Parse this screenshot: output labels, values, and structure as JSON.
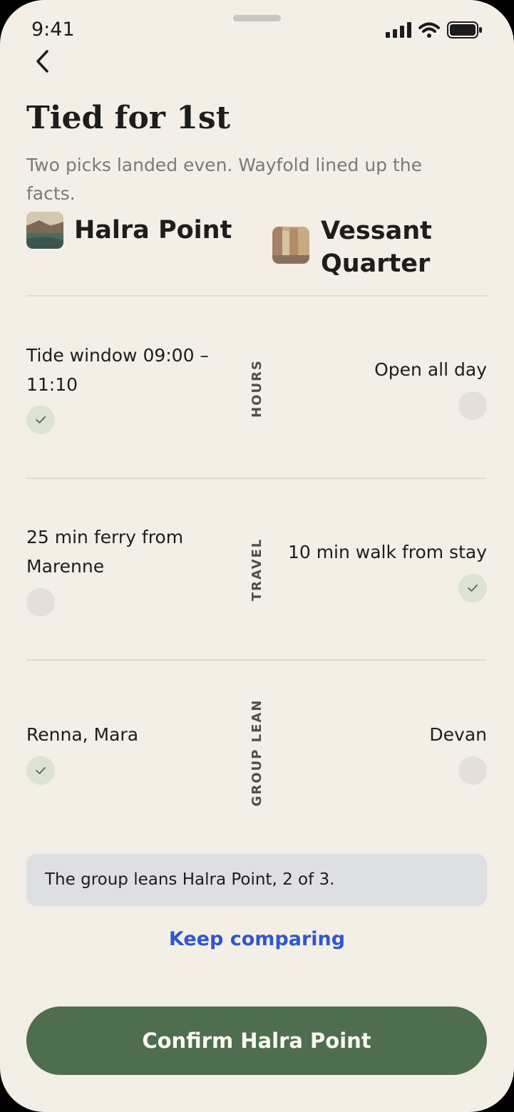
{
  "status": {
    "time": "9:41"
  },
  "header": {
    "title": "Tied for 1st",
    "subtitle": "Two picks landed even. Wayfold lined up the facts."
  },
  "options": [
    {
      "name": "Halra Point"
    },
    {
      "name": "Vessant Quarter"
    }
  ],
  "rows": [
    {
      "label": "HOURS",
      "left": "Tide window 09:00 – 11:10",
      "right": "Open all day",
      "left_checked": true,
      "right_checked": false
    },
    {
      "label": "TRAVEL",
      "left": "25 min ferry from Marenne",
      "right": "10 min walk from stay",
      "left_checked": false,
      "right_checked": true
    },
    {
      "label": "GROUP LEAN",
      "left": "Renna, Mara",
      "right": "Devan",
      "left_checked": true,
      "right_checked": false
    }
  ],
  "summary": "The group leans Halra Point, 2 of 3.",
  "actions": {
    "keep_comparing": "Keep comparing",
    "confirm": "Confirm Halra Point"
  },
  "colors": {
    "background": "#f3eee6",
    "primary_button": "#4f6d4f",
    "link": "#2d57cf",
    "check_fill": "#dde2d4",
    "empty_dot": "#e4e0d9"
  },
  "icons": [
    "back-chevron-icon",
    "cellular-signal-icon",
    "wifi-icon",
    "battery-icon",
    "checkmark-icon"
  ]
}
